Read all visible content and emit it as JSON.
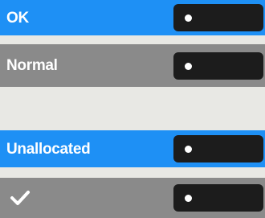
{
  "rows": [
    {
      "label": "OK",
      "style": "blue"
    },
    {
      "label": "Normal",
      "style": "gray"
    },
    {
      "label": "Unallocated",
      "style": "blue"
    },
    {
      "label": "",
      "icon": "checkmark-icon",
      "style": "gray"
    }
  ],
  "colors": {
    "blue": "#1e90f5",
    "gray": "#8a8a8a",
    "background": "#e8e8e4",
    "key": "#1c1c1c"
  }
}
